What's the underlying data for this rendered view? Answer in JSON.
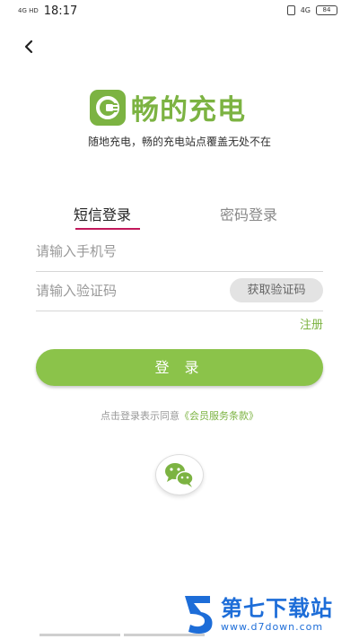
{
  "status_bar": {
    "signal": "4G HD",
    "time": "18:17",
    "network": "4G",
    "battery": "84"
  },
  "brand": {
    "title": "畅的充电",
    "slogan": "随地充电，畅的充电站点覆盖无处不在",
    "accent_color": "#7cb342"
  },
  "tabs": [
    {
      "label": "短信登录",
      "active": true
    },
    {
      "label": "密码登录",
      "active": false
    }
  ],
  "form": {
    "phone_placeholder": "请输入手机号",
    "code_placeholder": "请输入验证码",
    "get_code_label": "获取验证码",
    "register_label": "注册",
    "login_label": "登 录"
  },
  "agreement": {
    "prefix": "点击登录表示同意",
    "link": "《会员服务条款》"
  },
  "social": {
    "icon": "wechat-icon"
  },
  "watermark": {
    "title": "第七下载站",
    "url": "www.d7down.com"
  }
}
